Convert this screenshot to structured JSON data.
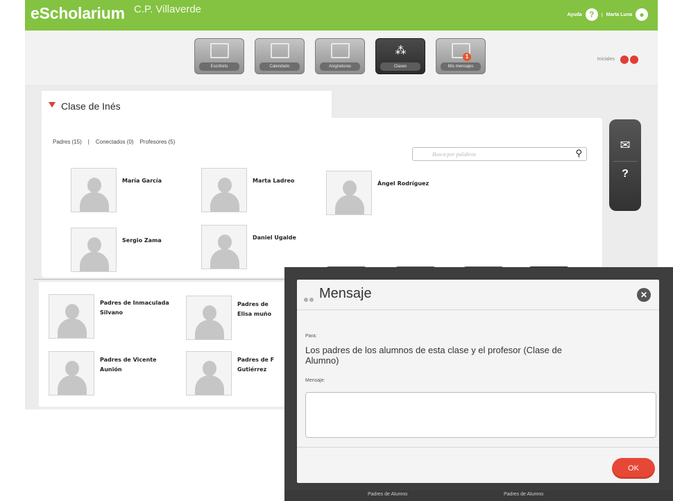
{
  "header": {
    "brand": "eScholarium",
    "school": "C.P. Villaverde",
    "help_label": "Ayuda",
    "help_icon": "?",
    "separator": "|",
    "user_name": "Marta Luna"
  },
  "nav": {
    "items": [
      {
        "label": "Escritorio",
        "icon": "desk-icon"
      },
      {
        "label": "Calendario",
        "icon": "calendar-icon"
      },
      {
        "label": "Asignaturas",
        "icon": "books-icon"
      },
      {
        "label": "Clases",
        "icon": "people-icon",
        "active": true
      },
      {
        "label": "Mis mensajes",
        "icon": "mail-icon",
        "badge": "1"
      }
    ],
    "iniciales": "Iniciales"
  },
  "class_panel": {
    "title": "Clase de Inés",
    "tabs": [
      "Padres (15)",
      "|",
      "Conectados (0)",
      "Profesores (5)"
    ],
    "search_placeholder": "Busca por palabras",
    "people": [
      "María García",
      "Marta Ladreo",
      "Ángel Rodríguez",
      "Sergio Zama",
      "Daniel Ugalde"
    ],
    "parents": [
      "Padres de Inmaculada Silvano",
      "Padres de Elisa muño",
      "Padres de Vicente Aunión",
      "Padres de F Gutiérrez"
    ]
  },
  "sidebar": {
    "mail_icon": "✉",
    "help_icon": "?"
  },
  "bottom_strip": {
    "left_label": "Padres de Alumno",
    "right_label": "Padres de Alumno"
  },
  "modal": {
    "title": "Mensaje",
    "close_icon": "✕",
    "to_label": "Para:",
    "to_value": "Los padres de los alumnos de esta clase y el profesor (Clase de Alumno)",
    "message_label": "Mensaje:",
    "message_value": "",
    "ok_label": "OK"
  },
  "colors": {
    "brand_green": "#83c341",
    "accent_red": "#e74736"
  }
}
